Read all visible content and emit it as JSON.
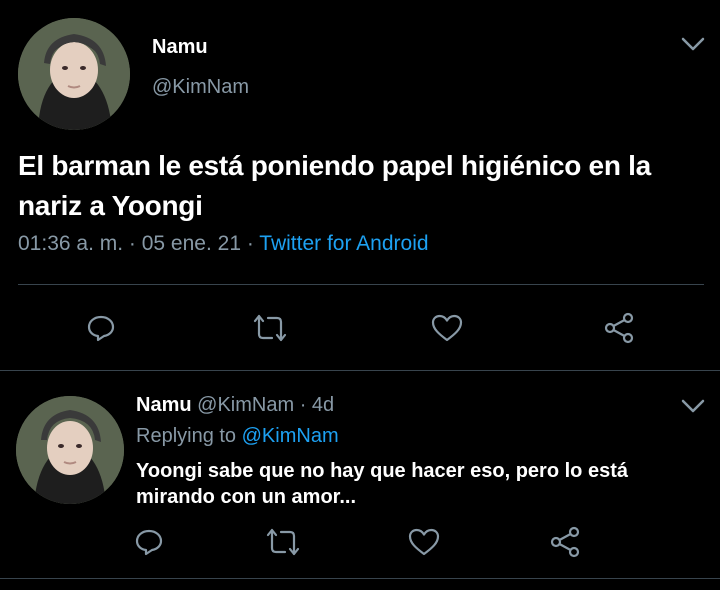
{
  "main_tweet": {
    "author_name": "Namu",
    "author_handle": "@KimNam",
    "avatar_icon": "profile-photo",
    "menu_icon": "chevron-down-icon",
    "text_line1": "El barman le está poniendo papel higiénico en la",
    "text_line2": "nariz a Yoongi",
    "time": "01:36 a. m.",
    "sep1": " · ",
    "date": "05 ene. 21",
    "sep2": " · ",
    "source": "Twitter for Android",
    "actions": [
      "reply-icon",
      "retweet-icon",
      "like-icon",
      "share-icon"
    ]
  },
  "reply_tweet": {
    "author_name": "Namu",
    "author_handle": "@KimNam",
    "age": "· 4d",
    "replying_prefix": "Replying to",
    "replying_to": "@KimNam",
    "text_line1": "Yoongi sabe que no hay que hacer eso, pero lo está",
    "text_line2": "mirando con un amor...",
    "menu_icon": "chevron-down-icon",
    "actions": [
      "reply-icon",
      "retweet-icon",
      "like-icon",
      "share-icon"
    ]
  },
  "colors": {
    "background": "#000000",
    "text": "#ffffff",
    "secondary": "#8899a6",
    "link": "#1da1f2",
    "divider": "#38444d"
  }
}
